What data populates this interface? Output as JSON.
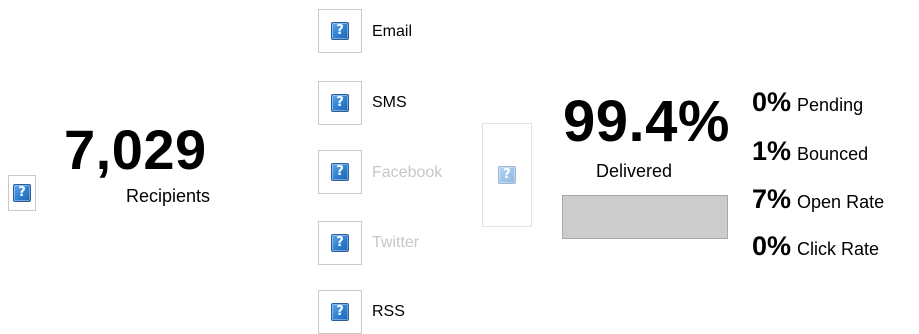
{
  "recipients": {
    "count": "7,029",
    "label": "Recipients",
    "icon": "broken-image-icon"
  },
  "channels": [
    {
      "label": "Email",
      "enabled": true,
      "icon": "broken-image-icon"
    },
    {
      "label": "SMS",
      "enabled": true,
      "icon": "broken-image-icon"
    },
    {
      "label": "Facebook",
      "enabled": false,
      "icon": "broken-image-icon"
    },
    {
      "label": "Twitter",
      "enabled": false,
      "icon": "broken-image-icon"
    },
    {
      "label": "RSS",
      "enabled": true,
      "icon": "broken-image-icon"
    }
  ],
  "delivery": {
    "percent": "99.4%",
    "label": "Delivered",
    "bar_fill_percent": 100
  },
  "stats": [
    {
      "percent": "0%",
      "label": "Pending"
    },
    {
      "percent": "1%",
      "label": "Bounced"
    },
    {
      "percent": "7%",
      "label": "Open Rate"
    },
    {
      "percent": "0%",
      "label": "Click Rate"
    }
  ],
  "colors": {
    "text": "#000000",
    "disabled_text": "#c7c7c7",
    "bar_fill": "#cccccc",
    "bar_border": "#a9a9a9",
    "icon_blue": "#2d7fd0"
  }
}
